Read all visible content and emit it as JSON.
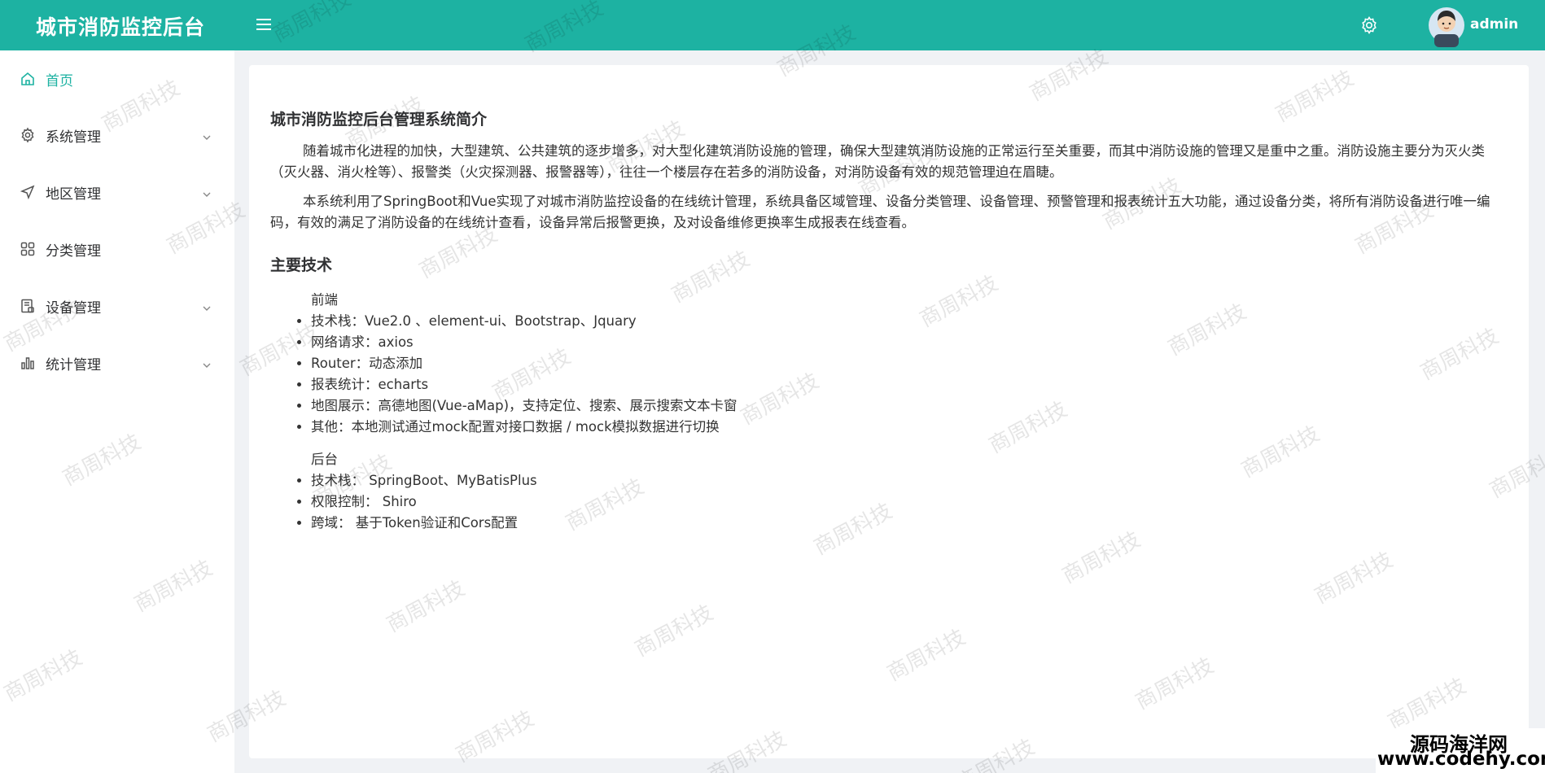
{
  "header": {
    "title": "城市消防监控后台",
    "username": "admin",
    "accent_color": "#1db2a2",
    "icons": {
      "menu": "hamburger-icon",
      "settings": "gear-icon",
      "avatar": "user-avatar"
    }
  },
  "sidebar": {
    "items": [
      {
        "label": "首页",
        "icon": "home-icon",
        "active": true,
        "expandable": false
      },
      {
        "label": "系统管理",
        "icon": "gear-icon",
        "active": false,
        "expandable": true
      },
      {
        "label": "地区管理",
        "icon": "send-icon",
        "active": false,
        "expandable": true
      },
      {
        "label": "分类管理",
        "icon": "grid-icon",
        "active": false,
        "expandable": false
      },
      {
        "label": "设备管理",
        "icon": "device-icon",
        "active": false,
        "expandable": true
      },
      {
        "label": "统计管理",
        "icon": "bar-chart-icon",
        "active": false,
        "expandable": true
      }
    ]
  },
  "main": {
    "intro_title": "城市消防监控后台管理系统简介",
    "paragraphs": [
      "随着城市化进程的加快，大型建筑、公共建筑的逐步增多，对大型化建筑消防设施的管理，确保大型建筑消防设施的正常运行至关重要，而其中消防设施的管理又是重中之重。消防设施主要分为灭火类（灭火器、消火栓等）、报警类（火灾探测器、报警器等），往往一个楼层存在若多的消防设备，对消防设备有效的规范管理迫在眉睫。",
      "本系统利用了SpringBoot和Vue实现了对城市消防监控设备的在线统计管理，系统具备区域管理、设备分类管理、设备管理、预警管理和报表统计五大功能，通过设备分类，将所有消防设备进行唯一编码，有效的满足了消防设备的在线统计查看，设备异常后报警更换，及对设备维修更换率生成报表在线查看。"
    ],
    "tech_title": "主要技术",
    "frontend": {
      "label": "前端",
      "items": [
        "技术栈：Vue2.0 、element-ui、Bootstrap、Jquary",
        "网络请求：axios",
        "Router：动态添加",
        "报表统计：echarts",
        "地图展示：高德地图(Vue-aMap)，支持定位、搜索、展示搜索文本卡窗",
        "其他：本地测试通过mock配置对接口数据 / mock模拟数据进行切换"
      ]
    },
    "backend": {
      "label": "后台",
      "items": [
        "技术栈： SpringBoot、MyBatisPlus",
        "权限控制： Shiro",
        "跨域： 基于Token验证和Cors配置"
      ]
    }
  },
  "watermark_text": "商周科技",
  "corner_brand": {
    "line1": "源码海洋网",
    "line2": "www.codehy.com"
  }
}
